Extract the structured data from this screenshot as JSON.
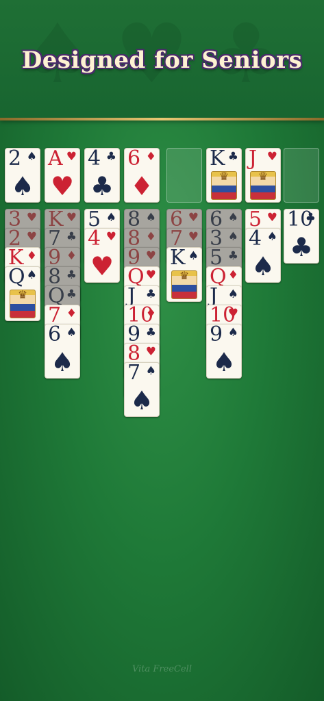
{
  "title": "Designed for Seniors",
  "footer": "Vita FreeCell",
  "colors": {
    "felt": "#1f7a38",
    "red_suit": "#cc2233",
    "black_suit": "#1c2a4a"
  },
  "foundations": [
    {
      "rank": "2",
      "suit": "♠",
      "color": "black"
    },
    {
      "rank": "A",
      "suit": "♥",
      "color": "red"
    },
    {
      "rank": "4",
      "suit": "♣",
      "color": "black"
    },
    {
      "rank": "6",
      "suit": "♦",
      "color": "red"
    }
  ],
  "freecells": [
    {
      "empty": true
    },
    {
      "rank": "K",
      "suit": "♣",
      "color": "black",
      "face": true
    },
    {
      "rank": "J",
      "suit": "♥",
      "color": "red",
      "face": true
    },
    {
      "empty": true
    }
  ],
  "tableau": [
    [
      {
        "rank": "3",
        "suit": "♥",
        "color": "red",
        "dim": true
      },
      {
        "rank": "2",
        "suit": "♥",
        "color": "red",
        "dim": true
      },
      {
        "rank": "K",
        "suit": "♦",
        "color": "red"
      },
      {
        "rank": "Q",
        "suit": "♠",
        "color": "black",
        "face": true
      }
    ],
    [
      {
        "rank": "K",
        "suit": "♥",
        "color": "red",
        "dim": true
      },
      {
        "rank": "7",
        "suit": "♣",
        "color": "black",
        "dim": true
      },
      {
        "rank": "9",
        "suit": "♦",
        "color": "red",
        "dim": true
      },
      {
        "rank": "8",
        "suit": "♣",
        "color": "black",
        "dim": true
      },
      {
        "rank": "Q",
        "suit": "♣",
        "color": "black",
        "dim": true
      },
      {
        "rank": "7",
        "suit": "♦",
        "color": "red"
      },
      {
        "rank": "6",
        "suit": "♠",
        "color": "black"
      }
    ],
    [
      {
        "rank": "5",
        "suit": "♠",
        "color": "black"
      },
      {
        "rank": "4",
        "suit": "♥",
        "color": "red"
      }
    ],
    [
      {
        "rank": "8",
        "suit": "♠",
        "color": "black",
        "dim": true
      },
      {
        "rank": "8",
        "suit": "♦",
        "color": "red",
        "dim": true
      },
      {
        "rank": "9",
        "suit": "♥",
        "color": "red",
        "dim": true
      },
      {
        "rank": "Q",
        "suit": "♥",
        "color": "red"
      },
      {
        "rank": "J",
        "suit": "♣",
        "color": "black"
      },
      {
        "rank": "10",
        "suit": "♦",
        "color": "red"
      },
      {
        "rank": "9",
        "suit": "♣",
        "color": "black"
      },
      {
        "rank": "8",
        "suit": "♥",
        "color": "red"
      },
      {
        "rank": "7",
        "suit": "♠",
        "color": "black"
      }
    ],
    [
      {
        "rank": "6",
        "suit": "♥",
        "color": "red",
        "dim": true
      },
      {
        "rank": "7",
        "suit": "♥",
        "color": "red",
        "dim": true
      },
      {
        "rank": "K",
        "suit": "♠",
        "color": "black",
        "face": true
      }
    ],
    [
      {
        "rank": "6",
        "suit": "♠",
        "color": "black",
        "dim": true
      },
      {
        "rank": "3",
        "suit": "♠",
        "color": "black",
        "dim": true
      },
      {
        "rank": "5",
        "suit": "♣",
        "color": "black",
        "dim": true
      },
      {
        "rank": "Q",
        "suit": "♦",
        "color": "red"
      },
      {
        "rank": "J",
        "suit": "♠",
        "color": "black"
      },
      {
        "rank": "10",
        "suit": "♥",
        "color": "red"
      },
      {
        "rank": "9",
        "suit": "♠",
        "color": "black"
      }
    ],
    [
      {
        "rank": "5",
        "suit": "♥",
        "color": "red"
      },
      {
        "rank": "4",
        "suit": "♠",
        "color": "black"
      }
    ],
    [
      {
        "rank": "10",
        "suit": "♣",
        "color": "black"
      }
    ]
  ]
}
